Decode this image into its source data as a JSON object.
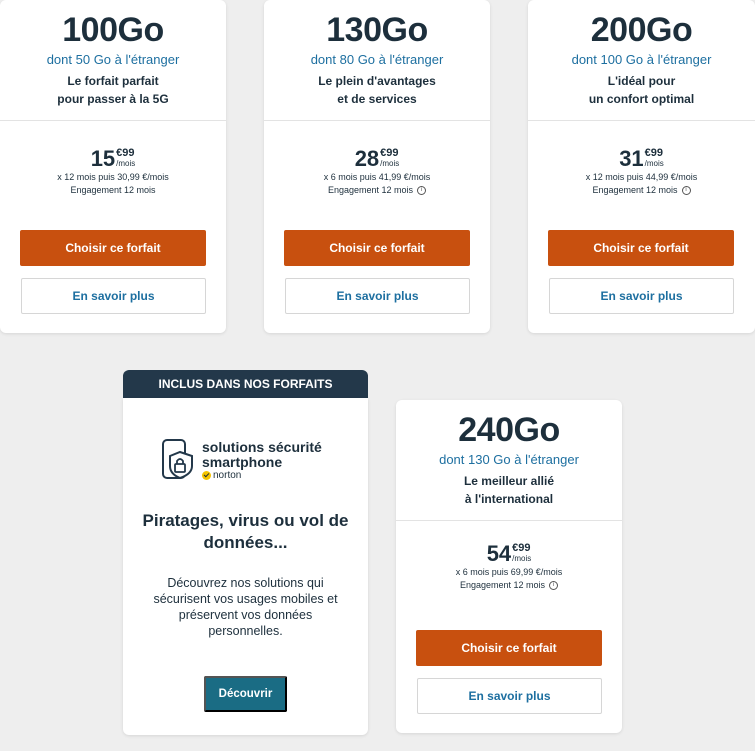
{
  "plans": [
    {
      "data": "100Go",
      "abroad": "dont 50 Go à l'étranger",
      "tagline1": "Le forfait parfait",
      "tagline2": "pour passer à la 5G",
      "price_int": "15",
      "price_cents": "€99",
      "price_unit": "/mois",
      "price_detail": "x 12 mois puis 30,99 €/mois",
      "engagement": "Engagement 12 mois",
      "has_info": false,
      "choose_label": "Choisir ce forfait",
      "more_label": "En savoir plus"
    },
    {
      "data": "130Go",
      "abroad": "dont 80 Go à l'étranger",
      "tagline1": "Le plein d'avantages",
      "tagline2": "et de services",
      "price_int": "28",
      "price_cents": "€99",
      "price_unit": "/mois",
      "price_detail": "x 6 mois puis 41,99 €/mois",
      "engagement": "Engagement 12 mois",
      "has_info": true,
      "choose_label": "Choisir ce forfait",
      "more_label": "En savoir plus"
    },
    {
      "data": "200Go",
      "abroad": "dont 100 Go à l'étranger",
      "tagline1": "L'idéal pour",
      "tagline2": "un confort optimal",
      "price_int": "31",
      "price_cents": "€99",
      "price_unit": "/mois",
      "price_detail": "x 12 mois puis 44,99 €/mois",
      "engagement": "Engagement 12 mois",
      "has_info": true,
      "choose_label": "Choisir ce forfait",
      "more_label": "En savoir plus"
    },
    {
      "data": "240Go",
      "abroad": "dont 130 Go à l'étranger",
      "tagline1": "Le meilleur allié",
      "tagline2": "à l'international",
      "price_int": "54",
      "price_cents": "€99",
      "price_unit": "/mois",
      "price_detail": "x 6 mois puis 69,99 €/mois",
      "engagement": "Engagement 12 mois",
      "has_info": true,
      "choose_label": "Choisir ce forfait",
      "more_label": "En savoir plus"
    }
  ],
  "info_glyph": "i",
  "promo": {
    "banner": "INCLUS DANS NOS FORFAITS",
    "logo_line1": "solutions sécurité",
    "logo_line2": "smartphone",
    "logo_brand": "norton",
    "title": "Piratages, virus ou vol de données...",
    "description": "Découvrez nos solutions qui sécurisent vos usages mobiles et préservent vos données personnelles.",
    "button": "Découvrir"
  },
  "colors": {
    "orange": "#c8500f",
    "navy": "#1d2f3c",
    "blue_text": "#1d6fa0",
    "teal": "#1a6c84",
    "banner": "#23384a"
  }
}
